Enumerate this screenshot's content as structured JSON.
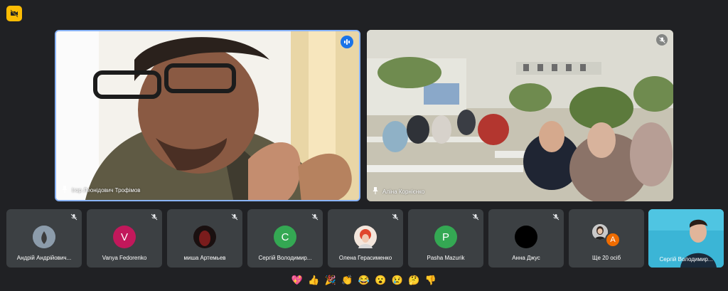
{
  "tiles": {
    "main": [
      {
        "name": "Ігор Леонідович Трофімов"
      },
      {
        "name": "Аліна Корнієнко"
      }
    ]
  },
  "participants": [
    {
      "name": "Андрій Андрійович..."
    },
    {
      "name": "Vanya Fedorenko",
      "initial": "V",
      "color": "#c2185b"
    },
    {
      "name": "миша Артемьев"
    },
    {
      "name": "Сергій Володимир...",
      "initial": "C",
      "color": "#34a853"
    },
    {
      "name": "Олена Герасименко"
    },
    {
      "name": "Pasha Mazurik",
      "initial": "P",
      "color": "#34a853"
    },
    {
      "name": "Анна Джус"
    },
    {
      "name": "Ще 20 осіб",
      "initial": "A",
      "color": "#ef6c00"
    },
    {
      "name": "Сергій Володимир..."
    }
  ],
  "reactions": [
    "💖",
    "👍",
    "🎉",
    "👏",
    "😂",
    "😮",
    "😢",
    "🤔",
    "👎"
  ],
  "colors": {
    "accent": "#8ab4f8",
    "badge": "#fbbc04",
    "tile": "#3c4043",
    "background": "#202124"
  }
}
